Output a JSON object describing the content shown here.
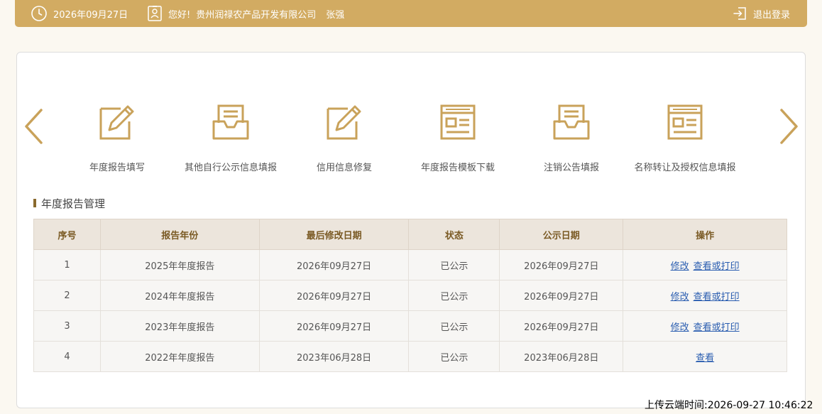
{
  "header": {
    "date": "2026年09月27日",
    "greeting": "您好!",
    "company": "贵州润禄农产品开发有限公司",
    "user": "张强",
    "logout": "退出登录"
  },
  "functions": [
    {
      "label": "年度报告填写",
      "icon": "edit-icon"
    },
    {
      "label": "其他自行公示信息填报",
      "icon": "inbox-doc-icon"
    },
    {
      "label": "信用信息修复",
      "icon": "edit-icon"
    },
    {
      "label": "年度报告模板下载",
      "icon": "browser-doc-icon"
    },
    {
      "label": "注销公告填报",
      "icon": "inbox-doc-icon"
    },
    {
      "label": "名称转让及授权信息填报",
      "icon": "browser-doc-icon"
    }
  ],
  "section": {
    "title": "年度报告管理"
  },
  "table": {
    "headers": [
      "序号",
      "报告年份",
      "最后修改日期",
      "状态",
      "公示日期",
      "操作"
    ],
    "rows": [
      {
        "no": "1",
        "year": "2025年年度报告",
        "modified": "2026年09月27日",
        "status": "已公示",
        "publish": "2026年09月27日",
        "actions": [
          "修改",
          "查看或打印"
        ]
      },
      {
        "no": "2",
        "year": "2024年年度报告",
        "modified": "2026年09月27日",
        "status": "已公示",
        "publish": "2026年09月27日",
        "actions": [
          "修改",
          "查看或打印"
        ]
      },
      {
        "no": "3",
        "year": "2023年年度报告",
        "modified": "2026年09月27日",
        "status": "已公示",
        "publish": "2026年09月27日",
        "actions": [
          "修改",
          "查看或打印"
        ]
      },
      {
        "no": "4",
        "year": "2022年年度报告",
        "modified": "2023年06月28日",
        "status": "已公示",
        "publish": "2023年06月28日",
        "actions": [
          "查看"
        ]
      }
    ]
  },
  "footer": {
    "upload_time": "上传云端时间:2026-09-27 10:46:22"
  },
  "colors": {
    "brand": "#d2ab62",
    "icon": "#c9a25a",
    "link": "#2a5db0",
    "header_text": "#7a5a24"
  }
}
